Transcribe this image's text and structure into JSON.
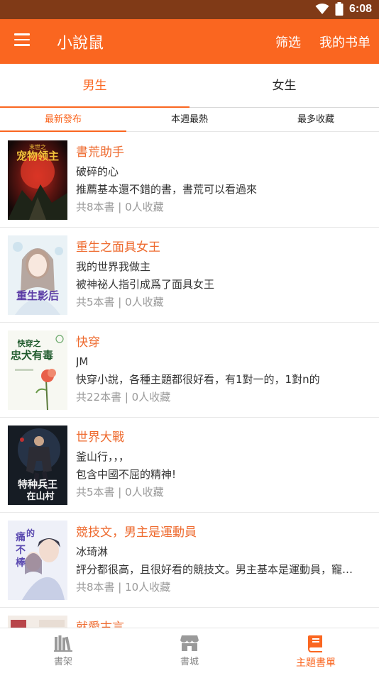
{
  "status_bar": {
    "time": "6:08"
  },
  "app_bar": {
    "title": "小說鼠",
    "actions": {
      "filter": "筛选",
      "my_list": "我的书单"
    }
  },
  "gender_tabs": [
    {
      "label": "男生",
      "active": true
    },
    {
      "label": "女生",
      "active": false
    }
  ],
  "sort_tabs": [
    {
      "label": "最新發布",
      "active": true
    },
    {
      "label": "本週最熱",
      "active": false
    },
    {
      "label": "最多收藏",
      "active": false
    }
  ],
  "booklists": [
    {
      "title": "書荒助手",
      "author": "破碎的心",
      "description": "推薦基本還不錯的書，書荒可以看過來",
      "stats": "共8本書 |  0人收藏",
      "cover_text": "末世之宠物领主"
    },
    {
      "title": "重生之面具女王",
      "author": "我的世界我做主",
      "description": "被神祕人指引成爲了面具女王",
      "stats": "共5本書 |  0人收藏",
      "cover_text": "重生影后"
    },
    {
      "title": "快穿",
      "author": "JM",
      "description": "快穿小說，各種主題都很好看，有1對一的，1對n的",
      "stats": "共22本書 |  0人收藏",
      "cover_text": "快穿之忠犬有毒"
    },
    {
      "title": "世界大戰",
      "author": "釜山行，，，",
      "description": "包含中國不屈的精神!",
      "stats": "共5本書 |  0人收藏",
      "cover_text": "特种兵王在山村"
    },
    {
      "title": "競技文，男主是運動員",
      "author": "冰琦淋",
      "description": "評分都很高，且很好看的競技文。男主基本是運動員，寵…",
      "stats": "共8本書 |  10人收藏",
      "cover_text": "痛不棒的"
    },
    {
      "title": "就愛古言",
      "author": "",
      "description": "",
      "stats": "",
      "cover_text": ""
    }
  ],
  "bottom_nav": [
    {
      "label": "書架",
      "icon": "bookshelf-icon",
      "active": false
    },
    {
      "label": "書城",
      "icon": "store-icon",
      "active": false
    },
    {
      "label": "主題書單",
      "icon": "booklist-icon",
      "active": true
    }
  ],
  "colors": {
    "accent": "#fa6620",
    "status_bar": "#803a17",
    "title_text": "#ee6a2e",
    "stats_text": "#9a9a9a"
  }
}
